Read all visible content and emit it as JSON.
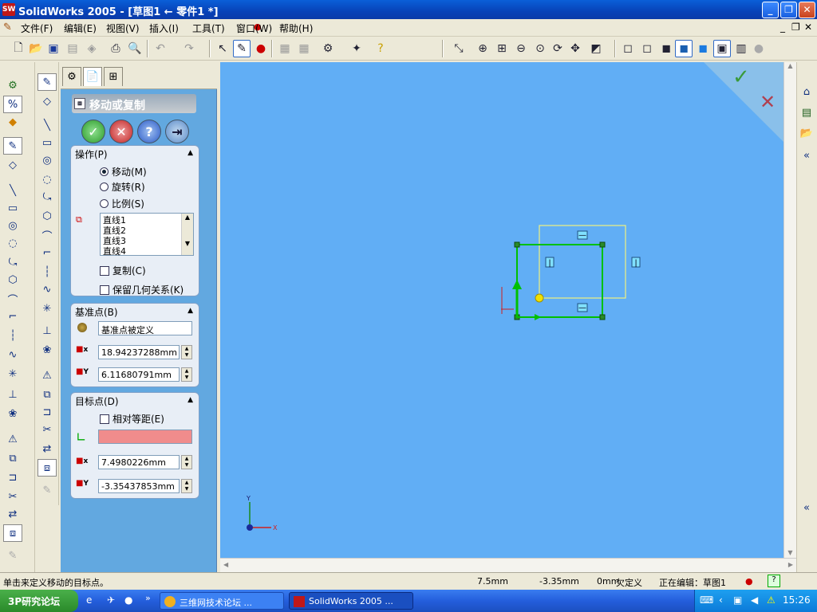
{
  "window": {
    "title": "SolidWorks 2005 - [草图1 ← 零件1 *]",
    "app_icon_text": "SW",
    "min_label": "_",
    "max_label": "❐",
    "close_label": "✕"
  },
  "menu": {
    "items": [
      "文件(F)",
      "编辑(E)",
      "视图(V)",
      "插入(I)",
      "工具(T)",
      "窗口(W)",
      "帮助(H)"
    ],
    "doc_min": "_",
    "doc_restore": "❐",
    "doc_close": "✕"
  },
  "property_manager": {
    "title": "移动或复制",
    "ok": "✓",
    "cancel": "✕",
    "help": "?",
    "pin": "⇥",
    "operation": {
      "header": "操作(P)",
      "options": [
        "移动(M)",
        "旋转(R)",
        "比例(S)"
      ],
      "selected": 0,
      "entities": [
        "直线1",
        "直线2",
        "直线3",
        "直线4"
      ],
      "copy_label": "复制(C)",
      "keep_relations_label": "保留几何关系(K)"
    },
    "base_point": {
      "header": "基准点(B)",
      "status": "基准点被定义",
      "x": "18.94237288mm",
      "y": "6.11680791mm"
    },
    "destination": {
      "header": "目标点(D)",
      "relative_label": "相对等距(E)",
      "x": "7.4980226mm",
      "y": "-3.35437853mm"
    },
    "axis_x": "x",
    "axis_y": "Y"
  },
  "graphics": {
    "triad_x": "X",
    "triad_y": "Y",
    "relation_glyph_h": "—",
    "relation_glyph_v": "|"
  },
  "status": {
    "message": "单击来定义移动的目标点。",
    "x": "7.5mm",
    "y": "-3.35mm",
    "z": "0mm",
    "definition": "欠定义",
    "editing": "正在编辑：草图1",
    "help": "?"
  },
  "taskbar": {
    "start_label": "3P研究论坛",
    "tasks": [
      "三维网技术论坛 ...",
      "SolidWorks 2005 ..."
    ],
    "clock": "15:26"
  },
  "colors": {
    "viewport": "#61aef5",
    "sketch": "#00c000",
    "preview": "#f0f080"
  }
}
